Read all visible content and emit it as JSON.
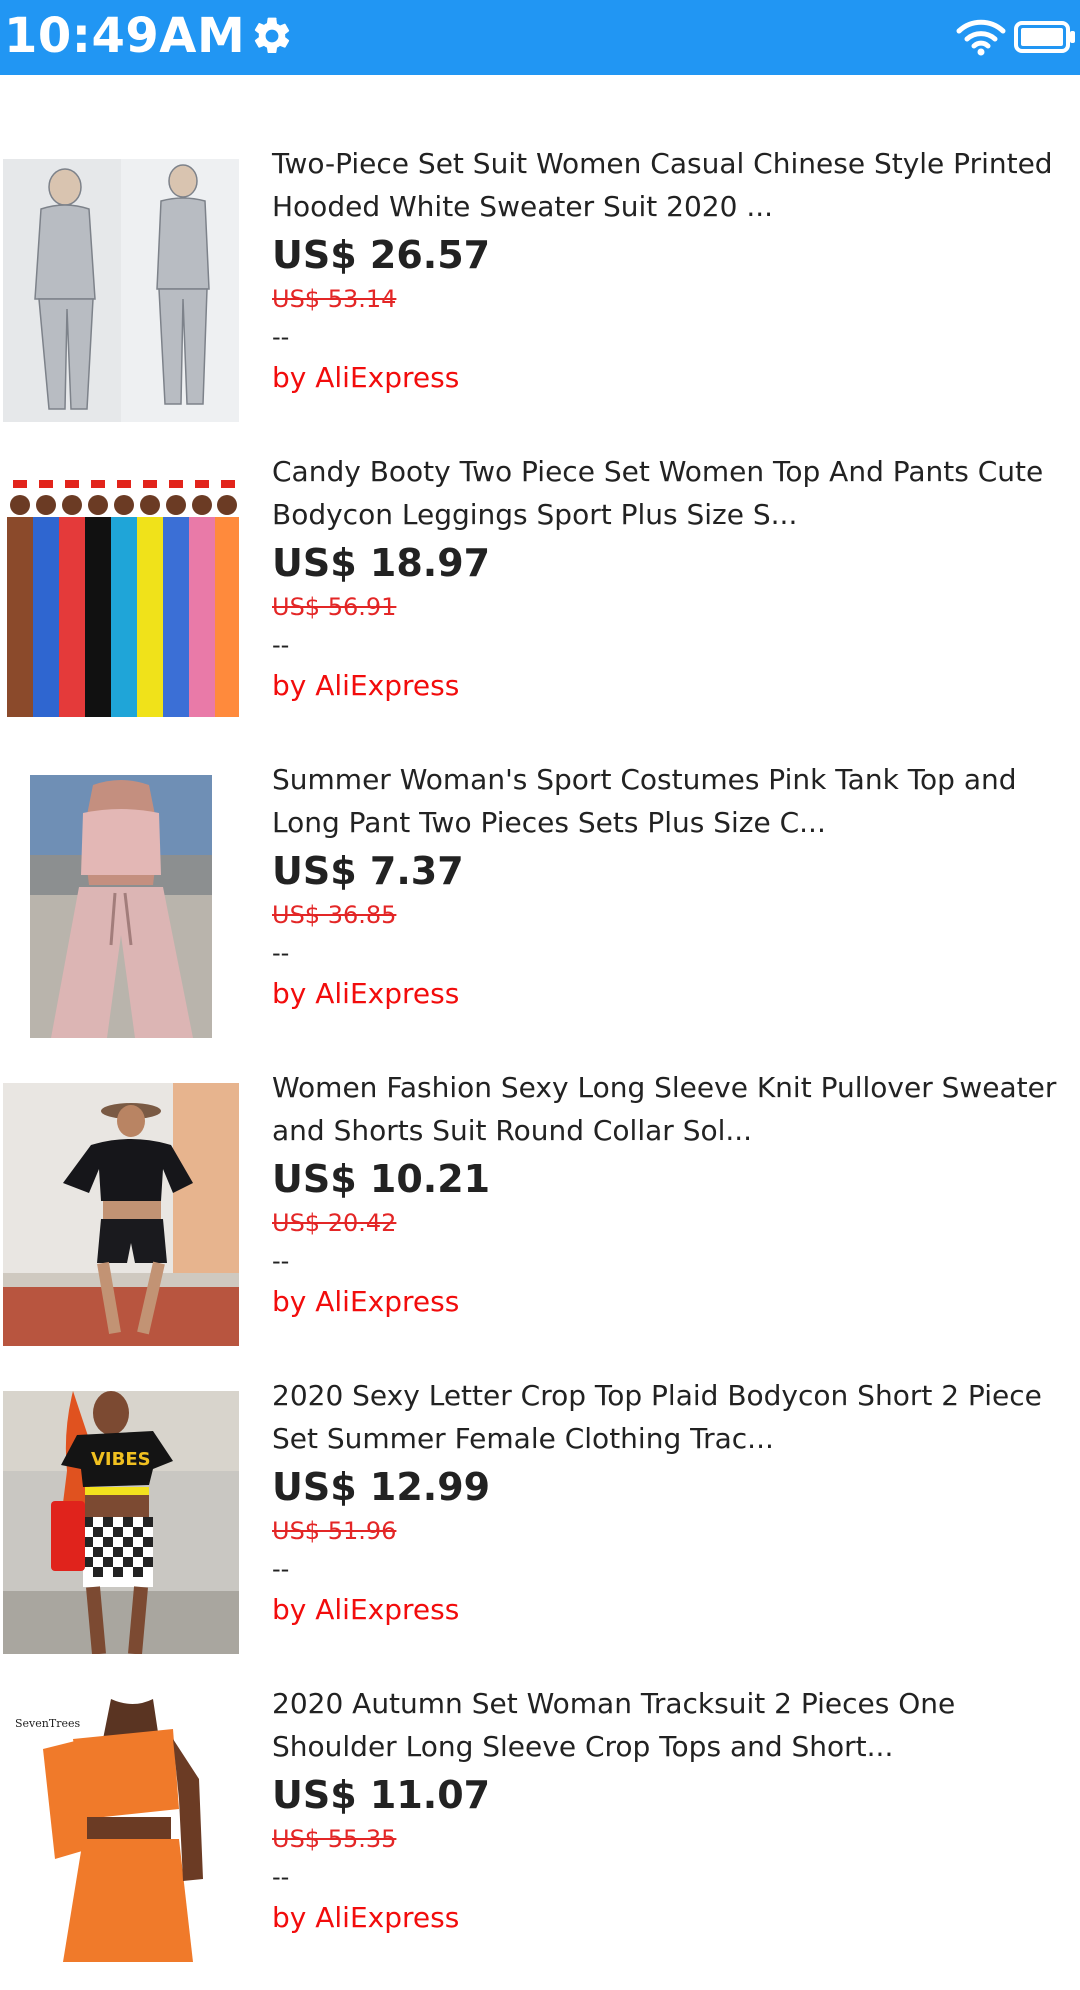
{
  "status_bar": {
    "time": "10:49AM",
    "background": "#2196f3",
    "icons": [
      "gear-icon",
      "wifi-icon",
      "battery-icon"
    ]
  },
  "colors": {
    "accent": "#2196f3",
    "old_price": "#e32626",
    "seller": "#f20c0c"
  },
  "products": [
    {
      "title": "Two-Piece Set Suit Women Casual Chinese Style Printed Hooded White Sweater Suit 2020 ...",
      "price": "US$ 26.57",
      "old_price": "US$ 53.14",
      "dash": "--",
      "seller": "by AliExpress"
    },
    {
      "title": "Candy Booty Two Piece Set Women Top And Pants Cute Bodycon Leggings Sport Plus Size S...",
      "price": "US$ 18.97",
      "old_price": "US$ 56.91",
      "dash": "--",
      "seller": "by AliExpress"
    },
    {
      "title": "Summer Woman's Sport Costumes Pink Tank Top and Long Pant Two Pieces Sets Plus Size C...",
      "price": "US$ 7.37",
      "old_price": "US$ 36.85",
      "dash": "--",
      "seller": "by AliExpress"
    },
    {
      "title": "Women Fashion Sexy Long Sleeve Knit Pullover Sweater and Shorts Suit Round Collar Sol...",
      "price": "US$ 10.21",
      "old_price": "US$ 20.42",
      "dash": "--",
      "seller": "by AliExpress"
    },
    {
      "title": "2020 Sexy Letter Crop Top Plaid Bodycon Short 2 Piece Set Summer Female Clothing Trac...",
      "price": "US$ 12.99",
      "old_price": "US$ 51.96",
      "dash": "--",
      "seller": "by AliExpress"
    },
    {
      "title": "2020 Autumn Set Woman Tracksuit 2 Pieces One Shoulder Long Sleeve Crop Tops and Short...",
      "price": "US$ 11.07",
      "old_price": "US$ 55.35",
      "dash": "--",
      "seller": "by AliExpress"
    }
  ]
}
